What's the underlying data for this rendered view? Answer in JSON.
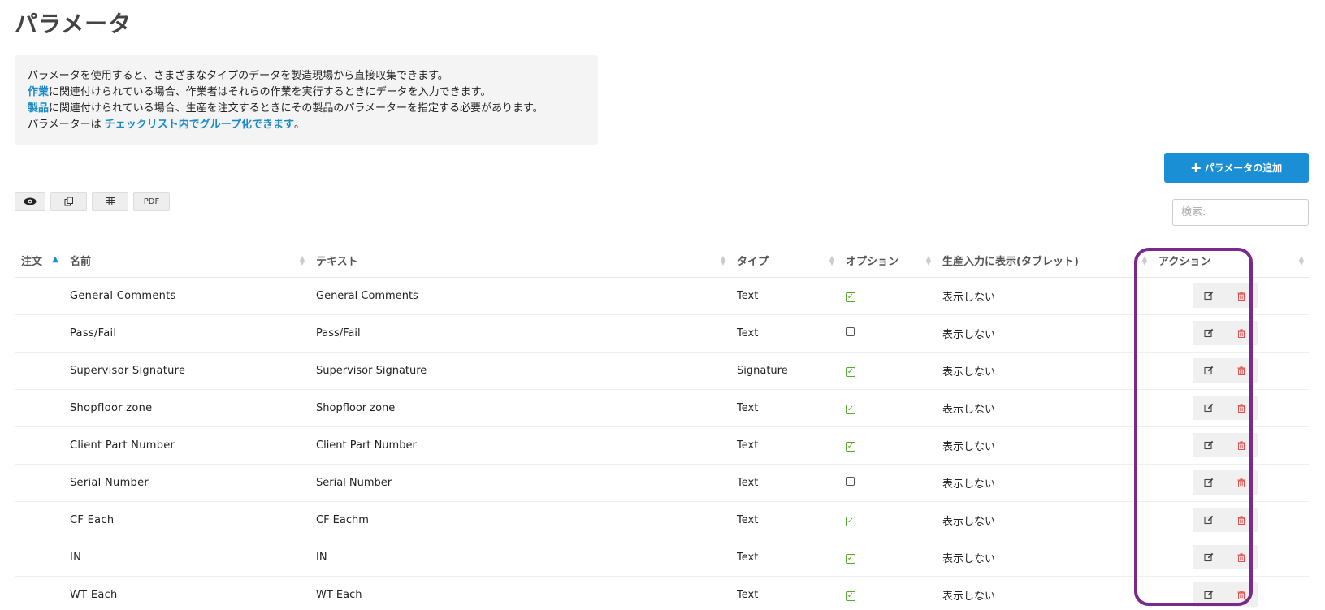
{
  "page": {
    "title": "パラメータ"
  },
  "info": {
    "line1": "パラメータを使用すると、さまざまなタイプのデータを製造現場から直接収集できます。",
    "line2_link": "作業",
    "line2_rest": "に関連付けられている場合、作業者はそれらの作業を実行するときにデータを入力できます。",
    "line3_link": "製品",
    "line3_rest": "に関連付けられている場合、生産を注文するときにその製品のパラメーターを指定する必要があります。",
    "line4_pre": "パラメーターは ",
    "line4_link": "チェックリスト内でグループ化できます",
    "line4_post": "。"
  },
  "add_button": {
    "label": "パラメータの追加",
    "icon": "plus-icon"
  },
  "toolbar": {
    "view_icon": "eye-icon",
    "copy_icon": "copy-icon",
    "table_icon": "table-icon",
    "pdf_label": "PDF"
  },
  "search": {
    "placeholder": "検索:"
  },
  "table": {
    "columns": {
      "order": "注文",
      "name": "名前",
      "text": "テキスト",
      "type": "タイプ",
      "option": "オプション",
      "tablet": "生産入力に表示(タブレット)",
      "action": "アクション"
    },
    "rows": [
      {
        "name": "General Comments",
        "text": "General Comments",
        "type": "Text",
        "option": true,
        "tablet": "表示しない"
      },
      {
        "name": "Pass/Fail",
        "text": "Pass/Fail",
        "type": "Text",
        "option": false,
        "tablet": "表示しない"
      },
      {
        "name": "Supervisor Signature",
        "text": "Supervisor Signature",
        "type": "Signature",
        "option": true,
        "tablet": "表示しない"
      },
      {
        "name": "Shopfloor zone",
        "text": "Shopfloor zone",
        "type": "Text",
        "option": true,
        "tablet": "表示しない"
      },
      {
        "name": "Client Part Number",
        "text": "Client Part Number",
        "type": "Text",
        "option": true,
        "tablet": "表示しない"
      },
      {
        "name": "Serial Number",
        "text": "Serial Number",
        "type": "Text",
        "option": false,
        "tablet": "表示しない"
      },
      {
        "name": "CF Each",
        "text": "CF Eachm",
        "type": "Text",
        "option": true,
        "tablet": "表示しない"
      },
      {
        "name": "IN",
        "text": "IN",
        "type": "Text",
        "option": true,
        "tablet": "表示しない"
      },
      {
        "name": "WT Each",
        "text": "WT Each",
        "type": "Text",
        "option": true,
        "tablet": "表示しない"
      }
    ]
  },
  "colors": {
    "accent": "#1a8fd6",
    "link": "#1a8ac9",
    "check_green": "#5aa832",
    "delete_red": "#e05252",
    "highlight_purple": "#7a2a8a"
  }
}
